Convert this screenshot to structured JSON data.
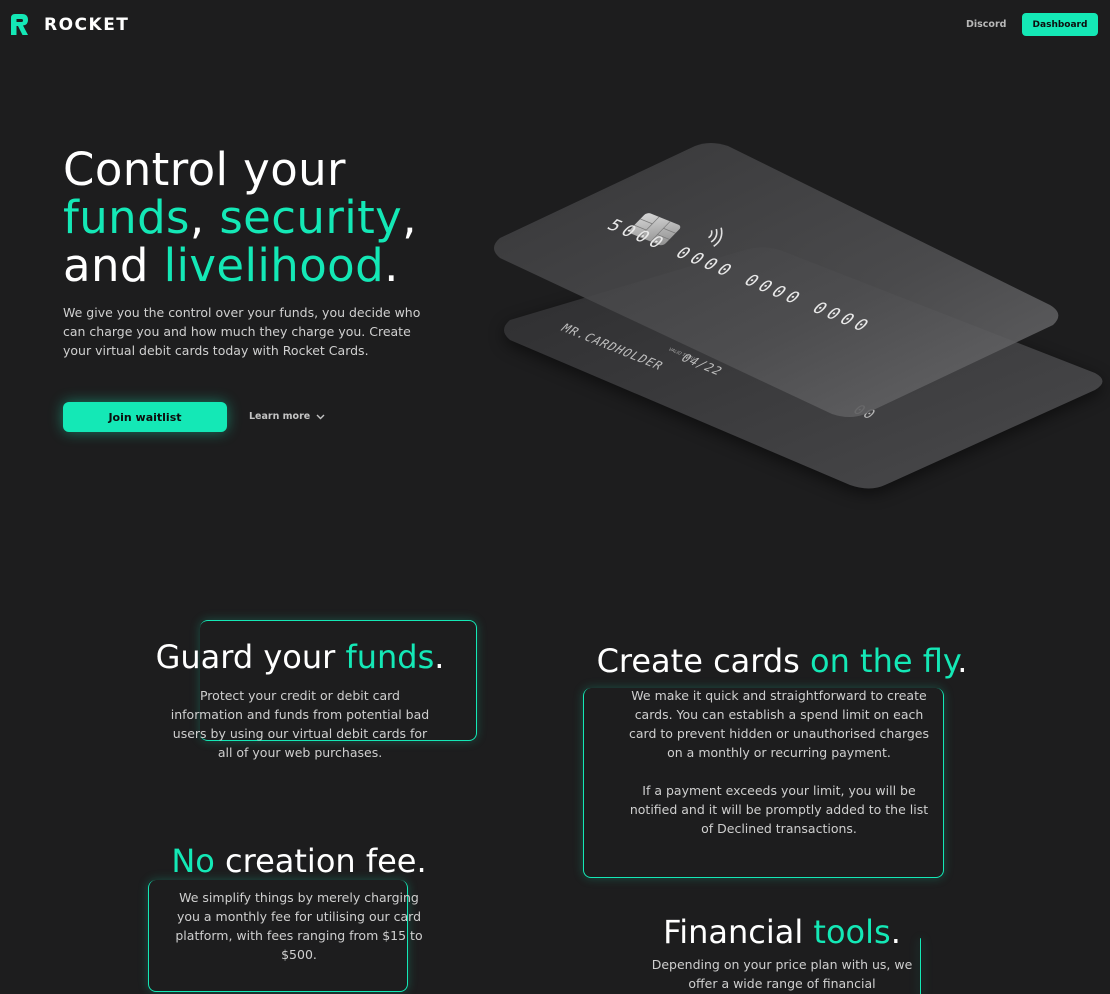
{
  "nav": {
    "brand": "ROCKET",
    "discord_label": "Discord",
    "dashboard_label": "Dashboard"
  },
  "hero": {
    "title_parts": [
      "Control your",
      "funds",
      ", ",
      "security",
      ",",
      "and ",
      "livelihood",
      "."
    ],
    "description": "We give you the control over your funds, you decide who can charge you and how much they charge you. Create your virtual debit cards today with Rocket Cards.",
    "join_label": "Join waitlist",
    "learn_more_label": "Learn more"
  },
  "card_art": {
    "number": "5000 0000 0000 0000",
    "holder": "MR.CARDHOLDER",
    "valid_label": "VALID THRU",
    "expiry": "04/22",
    "back_tail": "00"
  },
  "features": [
    {
      "title_pre": "Guard your ",
      "title_accent": "funds",
      "title_post": ".",
      "body": "Protect your credit or debit card information and funds from potential bad users by using our virtual debit cards for all of your web purchases."
    },
    {
      "title_pre": "Create cards ",
      "title_accent": "on the fly",
      "title_post": ".",
      "body": "We make it quick and straightforward to create cards. You can establish a spend limit on each card to prevent hidden or unauthorised charges on a monthly or recurring payment.",
      "body2": "If a payment exceeds your limit, you will be notified and it will be promptly added to the list of Declined transactions."
    },
    {
      "title_pre": "",
      "title_accent": "No",
      "title_post": " creation fee.",
      "body": "We simplify things by merely charging you a monthly fee for utilising our card platform, with fees ranging from $15 to $500."
    },
    {
      "title_pre": "Financial ",
      "title_accent": "tools",
      "title_post": ".",
      "body": "Depending on your price plan with us, we offer a wide range of financial"
    }
  ],
  "colors": {
    "accent": "#14e8b6",
    "background": "#1d1d1e"
  }
}
